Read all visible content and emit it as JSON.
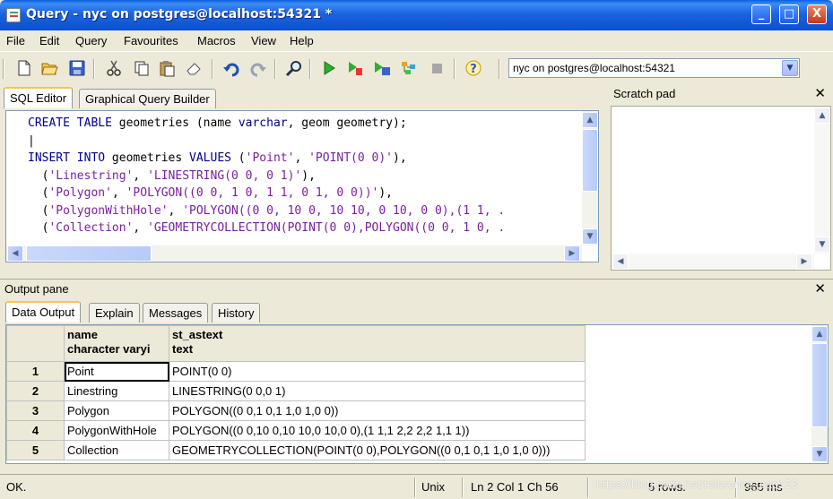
{
  "window": {
    "title": "Query - nyc on postgres@localhost:54321 *",
    "minimize": "_",
    "maximize": "□",
    "close": "X"
  },
  "menu": [
    "File",
    "Edit",
    "Query",
    "Favourites",
    "Macros",
    "View",
    "Help"
  ],
  "toolbar": {
    "icons": [
      "new-icon",
      "open-icon",
      "save-icon",
      "cut-icon",
      "copy-icon",
      "paste-icon",
      "clear-icon",
      "undo-icon",
      "redo-icon",
      "find-icon",
      "execute-icon",
      "execute-pgscript-icon",
      "execute-to-file-icon",
      "explain-icon",
      "cancel-icon",
      "help-icon"
    ],
    "connection": "nyc on postgres@localhost:54321"
  },
  "editor": {
    "tabs": [
      "SQL Editor",
      "Graphical Query Builder"
    ],
    "active_tab": "SQL Editor"
  },
  "scratch": {
    "title": "Scratch pad",
    "close": "✕"
  },
  "output": {
    "title": "Output pane",
    "close": "✕",
    "tabs": [
      "Data Output",
      "Explain",
      "Messages",
      "History"
    ],
    "columns": [
      {
        "name": "name",
        "type": "character varyi"
      },
      {
        "name": "st_astext",
        "type": "text"
      }
    ],
    "rows": [
      {
        "num": "1",
        "name": "Point",
        "text": "POINT(0 0)"
      },
      {
        "num": "2",
        "name": "Linestring",
        "text": "LINESTRING(0 0,0 1)"
      },
      {
        "num": "3",
        "name": "Polygon",
        "text": "POLYGON((0 0,1 0,1 1,0 1,0 0))"
      },
      {
        "num": "4",
        "name": "PolygonWithHole",
        "text": "POLYGON((0 0,10 0,10 10,0 10,0 0),(1 1,1 2,2 2,2 1,1 1))"
      },
      {
        "num": "5",
        "name": "Collection",
        "text": "GEOMETRYCOLLECTION(POINT(0 0),POLYGON((0 0,1 0,1 1,0 1,0 0)))"
      }
    ]
  },
  "status": {
    "message": "OK.",
    "line_ending": "Unix",
    "position": "Ln 2 Col 1 Ch 56",
    "rows": "5 rows.",
    "time": "965 ms",
    "watermark": "https://blog.csdn.net/reference_cao123"
  },
  "colors": {
    "keyword": "#00008b",
    "string": "#7a1fa0",
    "titlebar": "#0c4fcc"
  }
}
